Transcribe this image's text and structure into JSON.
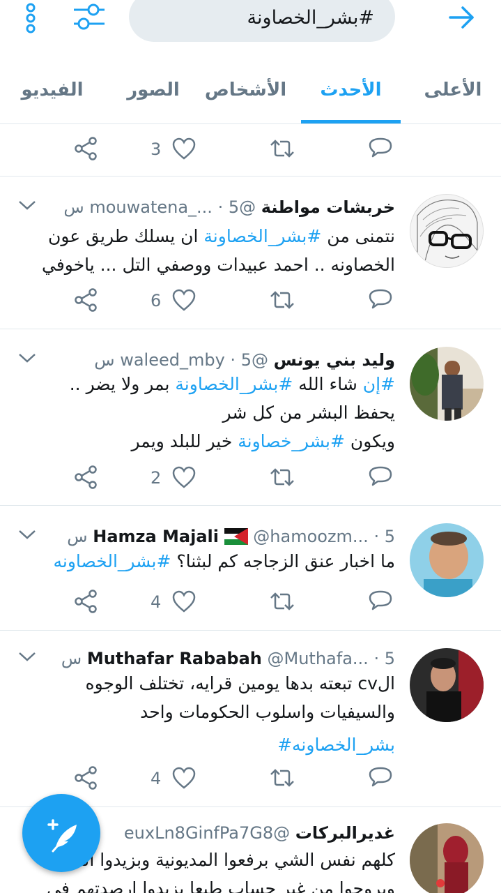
{
  "search": {
    "query": "#بشر_الخصاونة"
  },
  "tabs": [
    {
      "label": "الأعلى"
    },
    {
      "label": "الأحدث"
    },
    {
      "label": "الأشخاص"
    },
    {
      "label": "الصور"
    },
    {
      "label": "الفيديو"
    }
  ],
  "active_tab": "الأحدث",
  "colors": {
    "accent": "#1da1f2",
    "muted": "#657786",
    "divider": "#e1e8ed",
    "search_bg": "#e6ecf0"
  },
  "partial_tweet": {
    "likes": "3"
  },
  "tweets": [
    {
      "name": "خربشات مواطنة",
      "handle": "@mouwatena_...",
      "time": "5 س",
      "lines": [
        {
          "pre": "نتمنى من ",
          "tag": "#بشر_الخصاونة",
          "post": " ان يسلك طريق عون"
        },
        {
          "pre": "الخصاونه .. احمد عبيدات ووصفي التل ... ياخوفي",
          "tag": "",
          "post": ""
        }
      ],
      "likes": "6"
    },
    {
      "name": "وليد بني يونس",
      "handle": "@waleed_mby",
      "time": "5 س",
      "lines": [
        {
          "pre": "",
          "tag": "#إن",
          "post": " شاء الله "
        },
        {
          "pre": "يحفظ البشر من كل شر",
          "tag": "",
          "post": ""
        },
        {
          "pre": "ويكون ",
          "tag": "#بشر_خصاونة",
          "post": " خير للبلد ويمر"
        }
      ],
      "line1_tag2": "#بشر_الخصاونة",
      "line1_tail": " بمر ولا يضر ..",
      "likes": "2"
    },
    {
      "name": "Hamza Majali",
      "handle": "@hamoozm...",
      "time": "5 س",
      "lines": [
        {
          "pre": "ما اخبار عنق الزجاجه كم لبثنا؟ ",
          "tag": "#بشر_الخصاونه",
          "post": ""
        }
      ],
      "likes": "4"
    },
    {
      "name": "Muthafar Rababah",
      "handle": "@Muthafa...",
      "time": "5 س",
      "lines": [
        {
          "pre": "الcv تبعته بدها يومين قرايه، تختلف الوجوه",
          "tag": "",
          "post": ""
        },
        {
          "pre": "والسيفيات واسلوب الحكومات واحد",
          "tag": "",
          "post": ""
        },
        {
          "pre": "",
          "tag": "بشر_الخصاونه#",
          "post": ""
        }
      ],
      "likes": "4"
    },
    {
      "name": "غديرالبركات",
      "handle": "@euxLn8GinfPa7G8",
      "time": "",
      "lines": [
        {
          "pre": "كلهم نفس الشي برفعوا المديونية وبزيدوا الف",
          "tag": "",
          "post": ""
        },
        {
          "pre": "وبروحوا من غير حساب طبعا بزيدوا ارصدتهم في",
          "tag": "",
          "post": ""
        }
      ],
      "likes": ""
    }
  ]
}
